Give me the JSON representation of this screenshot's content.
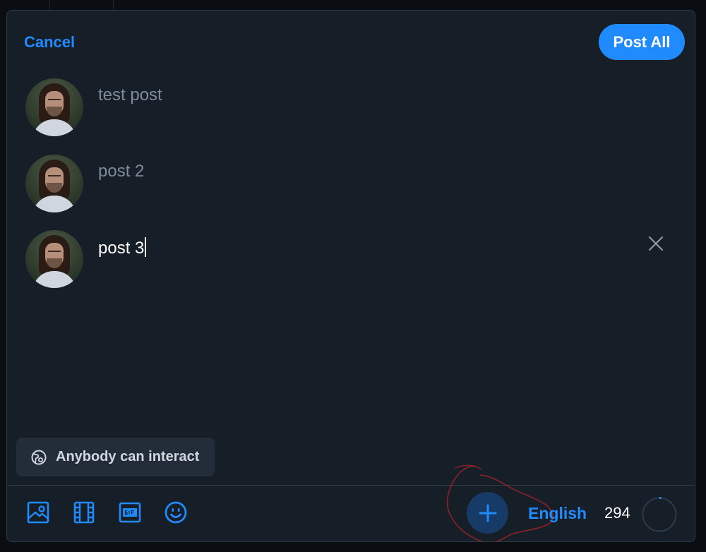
{
  "header": {
    "cancel_label": "Cancel",
    "post_all_label": "Post All"
  },
  "thread": {
    "posts": [
      {
        "text": "test post",
        "active": false
      },
      {
        "text": "post 2",
        "active": false
      },
      {
        "text": "post 3",
        "active": true
      }
    ]
  },
  "interaction_setting": {
    "label": "Anybody can interact",
    "icon": "globe-icon"
  },
  "toolbar": {
    "tools": [
      "image-icon",
      "video-icon",
      "gif-icon",
      "emoji-icon"
    ],
    "add_post_icon": "plus-icon",
    "language": "English",
    "characters_remaining": "294",
    "accent_color": "#208bfe"
  }
}
